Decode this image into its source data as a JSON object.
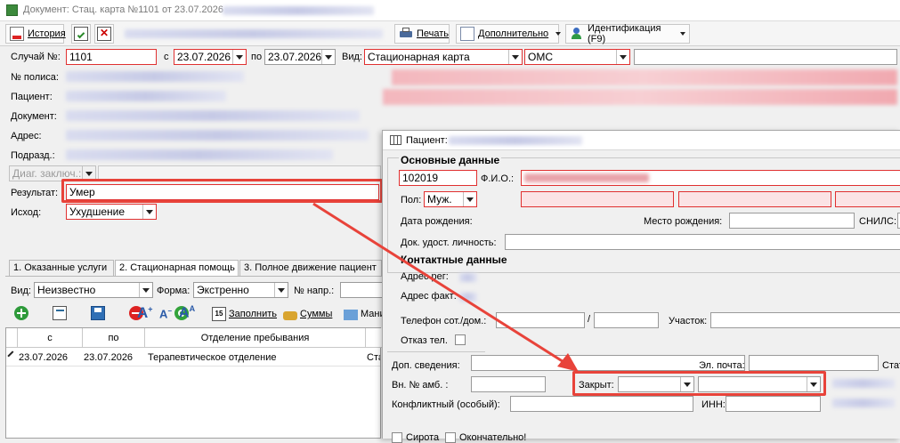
{
  "window": {
    "title": "Документ: Стац. карта №1101 от 23.07.2026"
  },
  "toolbar": {
    "history": "История",
    "print": "Печать",
    "more": "Дополнительно",
    "ident": "Идентификация (F9)"
  },
  "form": {
    "case_label": "Случай №:",
    "case_value": "1101",
    "from_label": "с",
    "from_value": "23.07.2026",
    "to_label": "по",
    "to_value": "23.07.2026",
    "kind_label": "Вид:",
    "kind_value": "Стационарная карта",
    "oms_value": "ОМС",
    "policy_label": "№ полиса:",
    "patient_label": "Пациент:",
    "document_label": "Документ:",
    "address_label": "Адрес:",
    "subdiv_label": "Подразд.:",
    "diag_label": "Диаг. заключ.:",
    "result_label": "Результат:",
    "result_value": "Умер",
    "outcome_label": "Исход:",
    "outcome_value": "Ухудшение"
  },
  "tabs": [
    {
      "label": "1. Оказанные услуги"
    },
    {
      "label": "2. Стационарная помощь"
    },
    {
      "label": "3. Полное движение пациент"
    }
  ],
  "filter": {
    "kind_label": "Вид:",
    "kind_value": "Неизвестно",
    "form_label": "Форма:",
    "form_value": "Экстренно",
    "ref_label": "№ напр.:"
  },
  "grid_toolbar": {
    "fill": "Заполнить",
    "sums": "Суммы",
    "more": "Мани"
  },
  "grid": {
    "headers": [
      "с",
      "по",
      "Отделение пребывания"
    ],
    "rows": [
      {
        "from": "23.07.2026",
        "to": "23.07.2026",
        "dept": "Терапевтическое отделение",
        "extra": "Ста"
      }
    ]
  },
  "dialog": {
    "title": "Пациент:",
    "basic_section": "Основные данные",
    "id_value": "102019",
    "fio_label": "Ф.И.О.:",
    "sex_label": "Пол:",
    "sex_value": "Муж.",
    "birth_label": "Дата рождения:",
    "birthplace_label": "Место рождения:",
    "snils_label": "СНИЛС:",
    "id_doc_label": "Док. удост. личность:",
    "contacts_section": "Контактные данные",
    "addr_reg_label": "Адрес рег:",
    "addr_fact_label": "Адрес факт:",
    "phone_label": "Телефон сот./дом.:",
    "phone_sep": "/",
    "district_label": "Участок:",
    "refuse_phone_label": "Отказ тел.",
    "extra_label": "Доп. сведения:",
    "email_label": "Эл. почта:",
    "stat_label": "Стат",
    "amb_label": "Вн. № амб. :",
    "closed_label": "Закрыт:",
    "conflict_label": "Конфликтный (особый):",
    "inn_label": "ИНН:",
    "bottom_cb1": "Сирота",
    "bottom_cb2": "Окончательно!"
  },
  "colors": {
    "highlight": "#e8433a",
    "field_error": "#e03030"
  }
}
